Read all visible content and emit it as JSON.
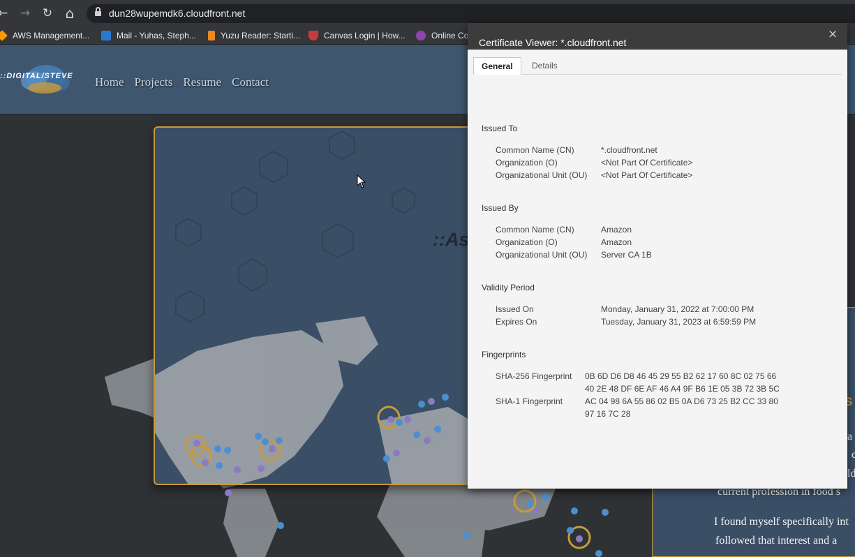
{
  "browser": {
    "nav": {
      "back": "←",
      "forward": "→",
      "reload": "↻",
      "home": "⌂"
    },
    "url": "dun28wupemdk6.cloudfront.net",
    "bookmarks": [
      {
        "label": "AWS Management...",
        "icon": "aws-icon",
        "color": "#ff9900"
      },
      {
        "label": "Mail - Yuhas, Steph...",
        "icon": "outlook-icon",
        "color": "#2b78d4"
      },
      {
        "label": "Yuzu Reader: Starti...",
        "icon": "yuzu-icon",
        "color": "#e98a1f"
      },
      {
        "label": "Canvas Login | How...",
        "icon": "canvas-icon",
        "color": "#c43c3c"
      },
      {
        "label": "Online Co",
        "icon": "online-icon",
        "color": "#8e44ad"
      }
    ]
  },
  "site": {
    "logo_text": "::DIGITAL/STEVE",
    "nav": [
      "Home",
      "Projects",
      "Resume",
      "Contact"
    ],
    "hero_title": "::As",
    "right_heading": "S",
    "paragraph_lines": [
      "a",
      "c",
      "ld",
      "current profession in food s",
      "I found myself specifically int",
      "followed that interest and a"
    ]
  },
  "certificate": {
    "title": "Certificate Viewer: *.cloudfront.net",
    "close": "×",
    "tabs": [
      "General",
      "Details"
    ],
    "active_tab": "General",
    "issued_to": {
      "heading": "Issued To",
      "rows": [
        {
          "label": "Common Name (CN)",
          "value": "*.cloudfront.net"
        },
        {
          "label": "Organization (O)",
          "value": "<Not Part Of Certificate>"
        },
        {
          "label": "Organizational Unit (OU)",
          "value": "<Not Part Of Certificate>"
        }
      ]
    },
    "issued_by": {
      "heading": "Issued By",
      "rows": [
        {
          "label": "Common Name (CN)",
          "value": "Amazon"
        },
        {
          "label": "Organization (O)",
          "value": "Amazon"
        },
        {
          "label": "Organizational Unit (OU)",
          "value": "Server CA 1B"
        }
      ]
    },
    "validity": {
      "heading": "Validity Period",
      "rows": [
        {
          "label": "Issued On",
          "value": "Monday, January 31, 2022 at 7:00:00 PM"
        },
        {
          "label": "Expires On",
          "value": "Tuesday, January 31, 2023 at 6:59:59 PM"
        }
      ]
    },
    "fingerprints": {
      "heading": "Fingerprints",
      "sha256_label": "SHA-256 Fingerprint",
      "sha256_lines": [
        "0B 6D D6 D8 46 45 29 55 B2 62 17 60 8C 02 75 66",
        "40 2E 48 DF 6E AF 46 A4 9F B6 1E 05 3B 72 3B 5C"
      ],
      "sha1_label": "SHA-1 Fingerprint",
      "sha1_lines": [
        "AC 04 98 6A 55 86 02 B5 0A D6 73 25 B2 CC 33 80",
        "97 16 7C 28"
      ]
    }
  },
  "colors": {
    "accent": "#c89a3c",
    "header": "#3e566e",
    "panel": "#3a4f66"
  }
}
